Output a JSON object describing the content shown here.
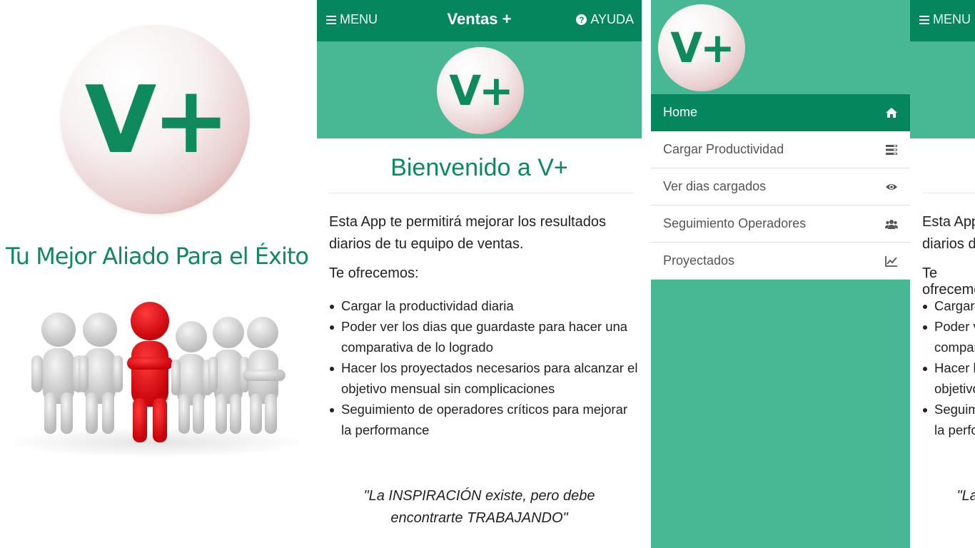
{
  "splash": {
    "logo_text": "V+",
    "tagline": "Tu Mejor Aliado Para el Éxito"
  },
  "app": {
    "menu_label": "MENU",
    "title": "Ventas +",
    "help_label": "AYUDA",
    "logo_text": "V+"
  },
  "home": {
    "welcome": "Bienvenido a V+",
    "intro": "Esta App te permitirá mejorar los resultados diarios de tu equipo de ventas.",
    "offer_heading": "Te ofrecemos:",
    "features": [
      "Cargar la productividad diaria",
      "Poder ver los dias que guardaste para hacer una comparativa de lo logrado",
      "Hacer los proyectados necesarios para alcanzar el objetivo mensual sin complicaciones",
      "Seguimiento de operadores críticos para mejorar la performance"
    ],
    "quote": "\"La INSPIRACIÓN existe, pero debe encontrarte TRABAJANDO\""
  },
  "side_menu": {
    "logo_text": "V+",
    "items": [
      {
        "label": "Home",
        "icon": "home-icon",
        "active": true
      },
      {
        "label": "Cargar Productividad",
        "icon": "list-icon",
        "active": false
      },
      {
        "label": "Ver dias cargados",
        "icon": "eye-icon",
        "active": false
      },
      {
        "label": "Seguimiento Operadores",
        "icon": "users-icon",
        "active": false
      },
      {
        "label": "Proyectados",
        "icon": "line-chart-icon",
        "active": false
      }
    ]
  },
  "partial": {
    "menu_label": "MENU",
    "intro": "Esta App te permitirá mejorar los resultados diarios de tu equipo de ventas.",
    "offer_heading": "Te ofrecemos:"
  },
  "colors": {
    "primary": "#06865d",
    "banner": "#48b894",
    "accent_text": "#0a8a5e",
    "figure_highlight": "#e8141b",
    "figure_gray": "#d9d9d9"
  }
}
